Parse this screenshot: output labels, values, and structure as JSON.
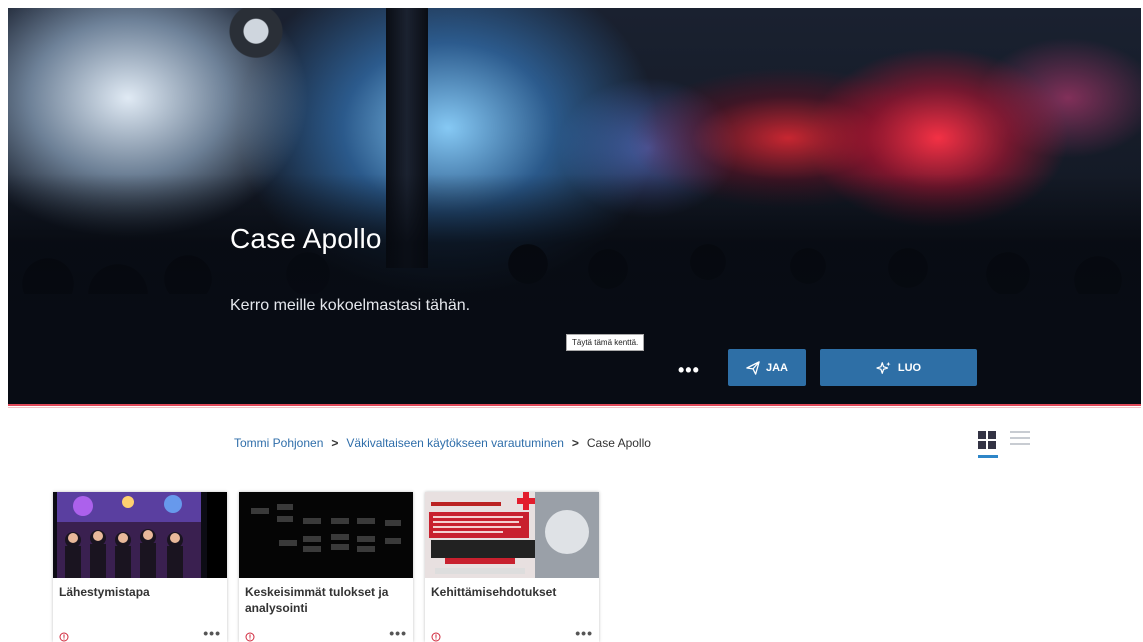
{
  "hero": {
    "title": "Case Apollo",
    "description": "Kerro meille kokoelmastasi tähän.",
    "tooltip": "Täytä tämä kenttä.",
    "more_label": "•••",
    "share_label": "JAA",
    "create_label": "LUO"
  },
  "breadcrumb": {
    "items": [
      "Tommi Pohjonen",
      "Väkivaltaiseen käytökseen varautuminen",
      "Case Apollo"
    ],
    "separator": ">"
  },
  "view": {
    "active": "grid"
  },
  "cards": [
    {
      "title": "Lähestymistapa",
      "more": "•••"
    },
    {
      "title": "Keskeisimmät tulokset ja analysointi",
      "more": "•••"
    },
    {
      "title": "Kehittämisehdotukset",
      "more": "•••"
    }
  ],
  "colors": {
    "accent": "#2e6fa6",
    "link": "#2f6eaa",
    "divider": "#e04a5a",
    "alert": "#d0283c"
  }
}
